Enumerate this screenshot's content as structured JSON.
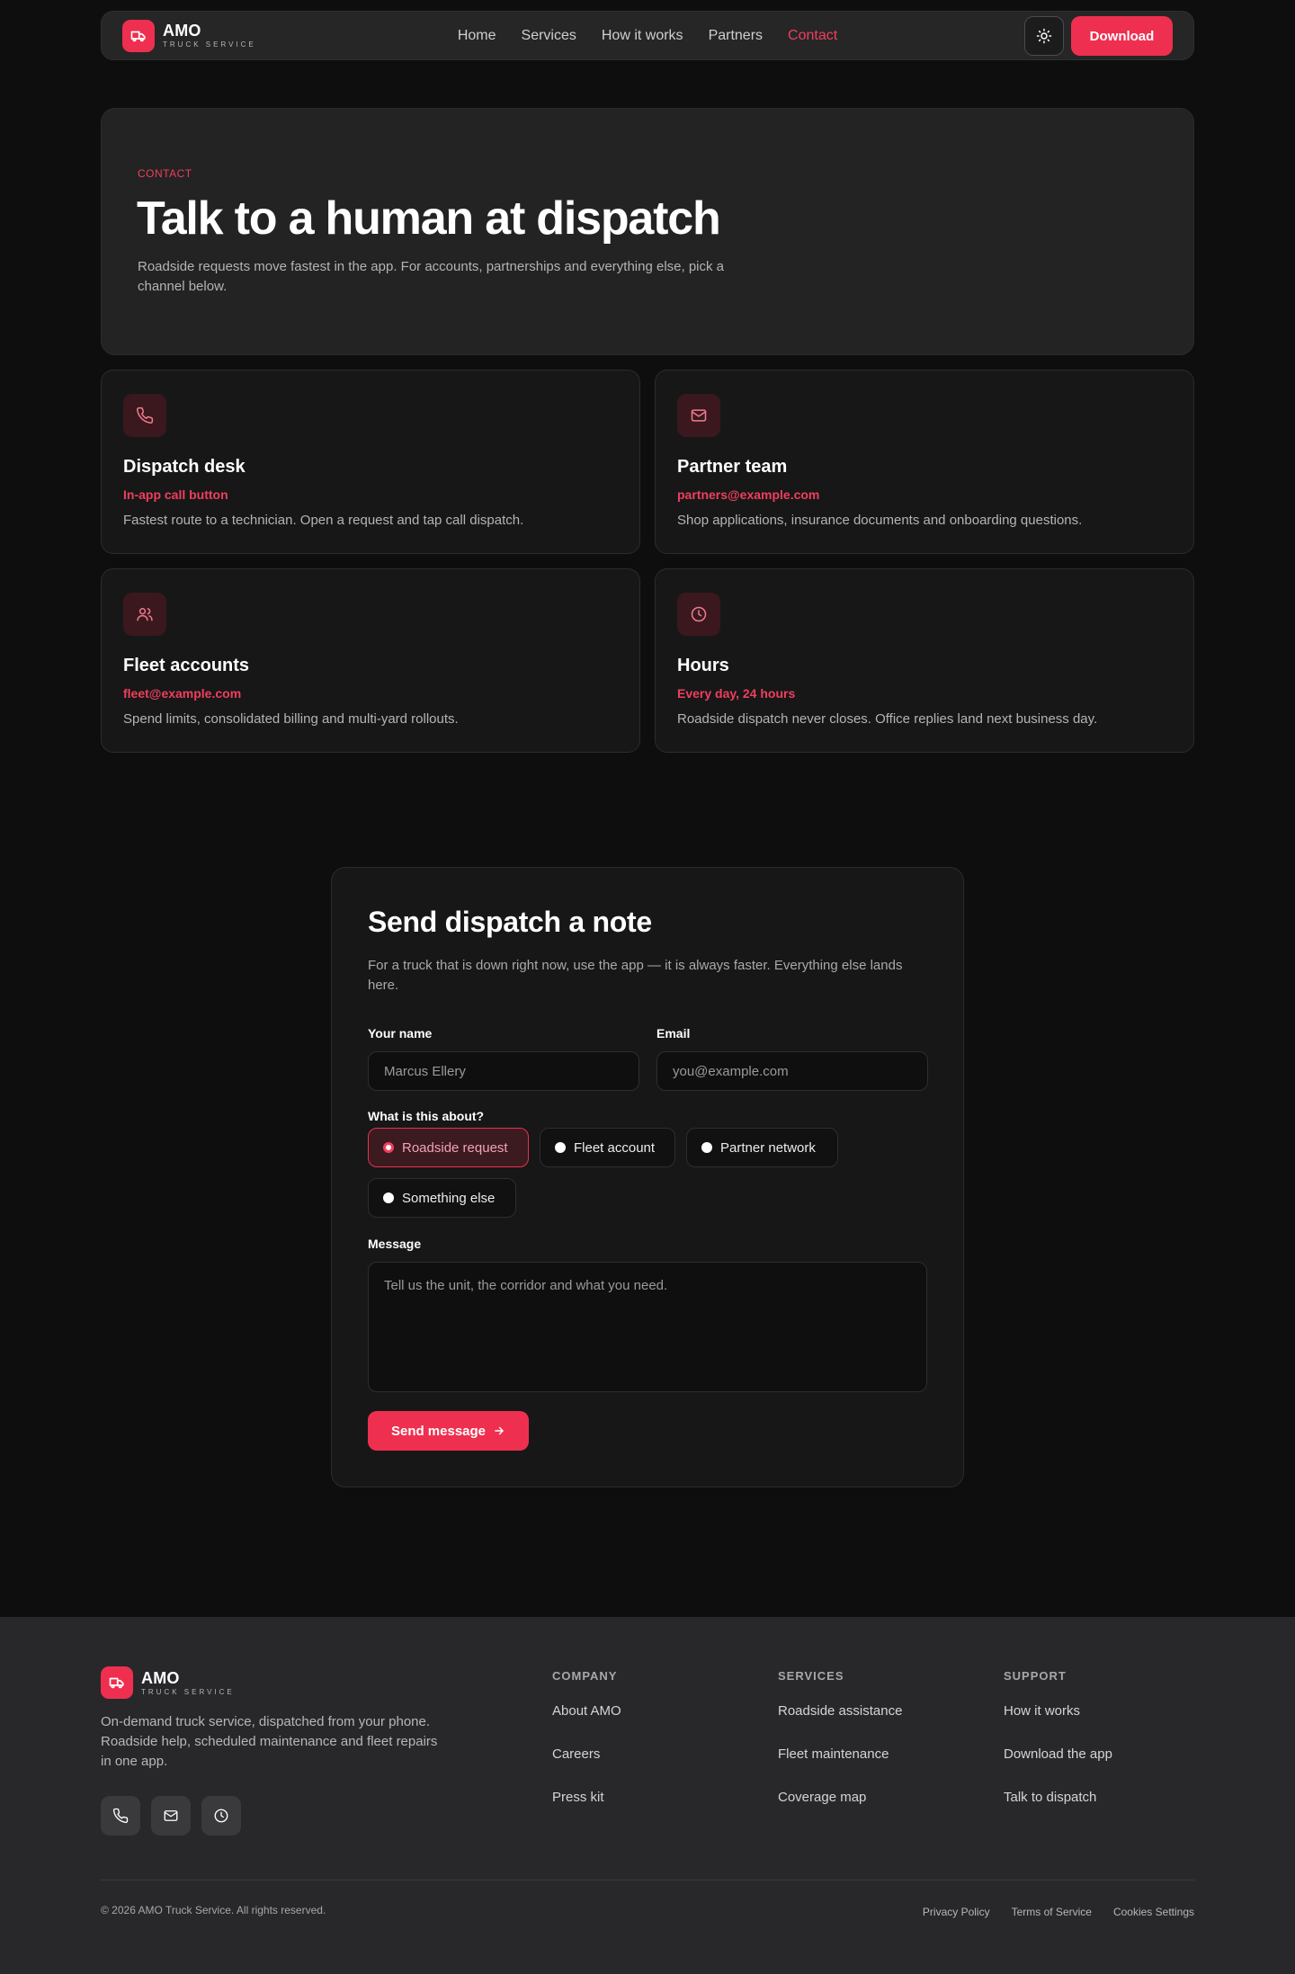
{
  "brand": {
    "name": "AMO",
    "subtitle": "TRUCK SERVICE"
  },
  "nav": {
    "links": [
      "Home",
      "Services",
      "How it works",
      "Partners",
      "Contact"
    ],
    "active": "Contact",
    "download_label": "Download"
  },
  "hero": {
    "eyebrow": "CONTACT",
    "title": "Talk to a human at dispatch",
    "subtitle": "Roadside requests move fastest in the app. For accounts, partnerships and everything else, pick a channel below."
  },
  "cards": [
    {
      "icon": "phone-icon",
      "title": "Dispatch desk",
      "accent": "In-app call button",
      "desc": "Fastest route to a technician. Open a request and tap call dispatch."
    },
    {
      "icon": "mail-icon",
      "title": "Partner team",
      "accent": "partners@example.com",
      "desc": "Shop applications, insurance documents and onboarding questions."
    },
    {
      "icon": "users-icon",
      "title": "Fleet accounts",
      "accent": "fleet@example.com",
      "desc": "Spend limits, consolidated billing and multi-yard rollouts."
    },
    {
      "icon": "clock-icon",
      "title": "Hours",
      "accent": "Every day, 24 hours",
      "desc": "Roadside dispatch never closes. Office replies land next business day."
    }
  ],
  "form": {
    "title": "Send dispatch a note",
    "intro": "For a truck that is down right now, use the app — it is always faster. Everything else lands here.",
    "name_label": "Your name",
    "name_placeholder": "Marcus Ellery",
    "email_label": "Email",
    "email_placeholder": "you@example.com",
    "topic_label": "What is this about?",
    "topics": [
      "Roadside request",
      "Fleet account",
      "Partner network",
      "Something else"
    ],
    "selected_topic": "Roadside request",
    "message_label": "Message",
    "message_placeholder": "Tell us the unit, the corridor and what you need.",
    "submit_label": "Send message"
  },
  "footer": {
    "tagline": "On-demand truck service, dispatched from your phone. Roadside help, scheduled maintenance and fleet repairs in one app.",
    "social_icons": [
      "phone-icon",
      "mail-icon",
      "clock-icon"
    ],
    "columns": [
      {
        "heading": "COMPANY",
        "links": [
          "About AMO",
          "Careers",
          "Press kit"
        ]
      },
      {
        "heading": "SERVICES",
        "links": [
          "Roadside assistance",
          "Fleet maintenance",
          "Coverage map"
        ]
      },
      {
        "heading": "SUPPORT",
        "links": [
          "How it works",
          "Download the app",
          "Talk to dispatch"
        ]
      }
    ],
    "copyright": "© 2026 AMO Truck Service. All rights reserved.",
    "legal": [
      "Privacy Policy",
      "Terms of Service",
      "Cookies Settings"
    ]
  },
  "colors": {
    "accent": "#ef2f4f",
    "background": "#0e0e0f",
    "surface": "#171718"
  }
}
